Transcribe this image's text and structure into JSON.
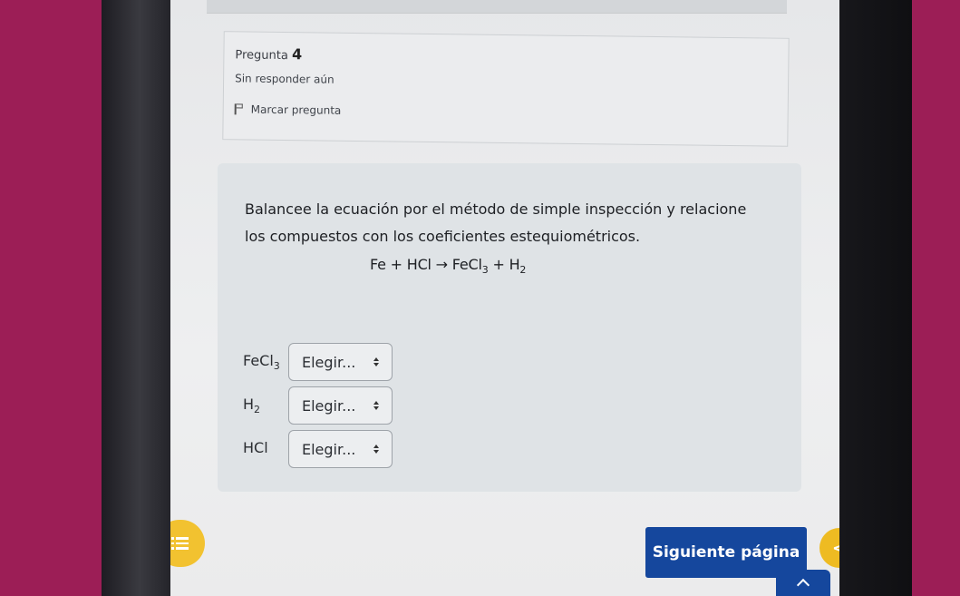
{
  "question": {
    "label": "Pregunta",
    "number": "4",
    "status": "Sin responder aún",
    "flag_label": "Marcar pregunta",
    "text": "Balancee la ecuación por el método de simple inspección y relacione los compuestos con los coeficientes estequiométricos.",
    "equation": {
      "part1": "Fe + HCl → FeCl",
      "sub1": "3",
      "part2": " + H",
      "sub2": "2"
    }
  },
  "rows": [
    {
      "compound": "FeCl",
      "sub": "3",
      "select_value": "Elegir..."
    },
    {
      "compound": "H",
      "sub": "2",
      "select_value": "Elegir..."
    },
    {
      "compound": "HCl",
      "sub": "",
      "select_value": "Elegir..."
    }
  ],
  "nav": {
    "next_label": "Siguiente página",
    "prev_symbol": "<",
    "icons": [
      "list-icon",
      "caret-up-icon",
      "flag-icon",
      "select-arrows-icon"
    ]
  },
  "colors": {
    "primary": "#15479d",
    "accent": "#f2c230",
    "background_outside": "#9c1e56"
  }
}
